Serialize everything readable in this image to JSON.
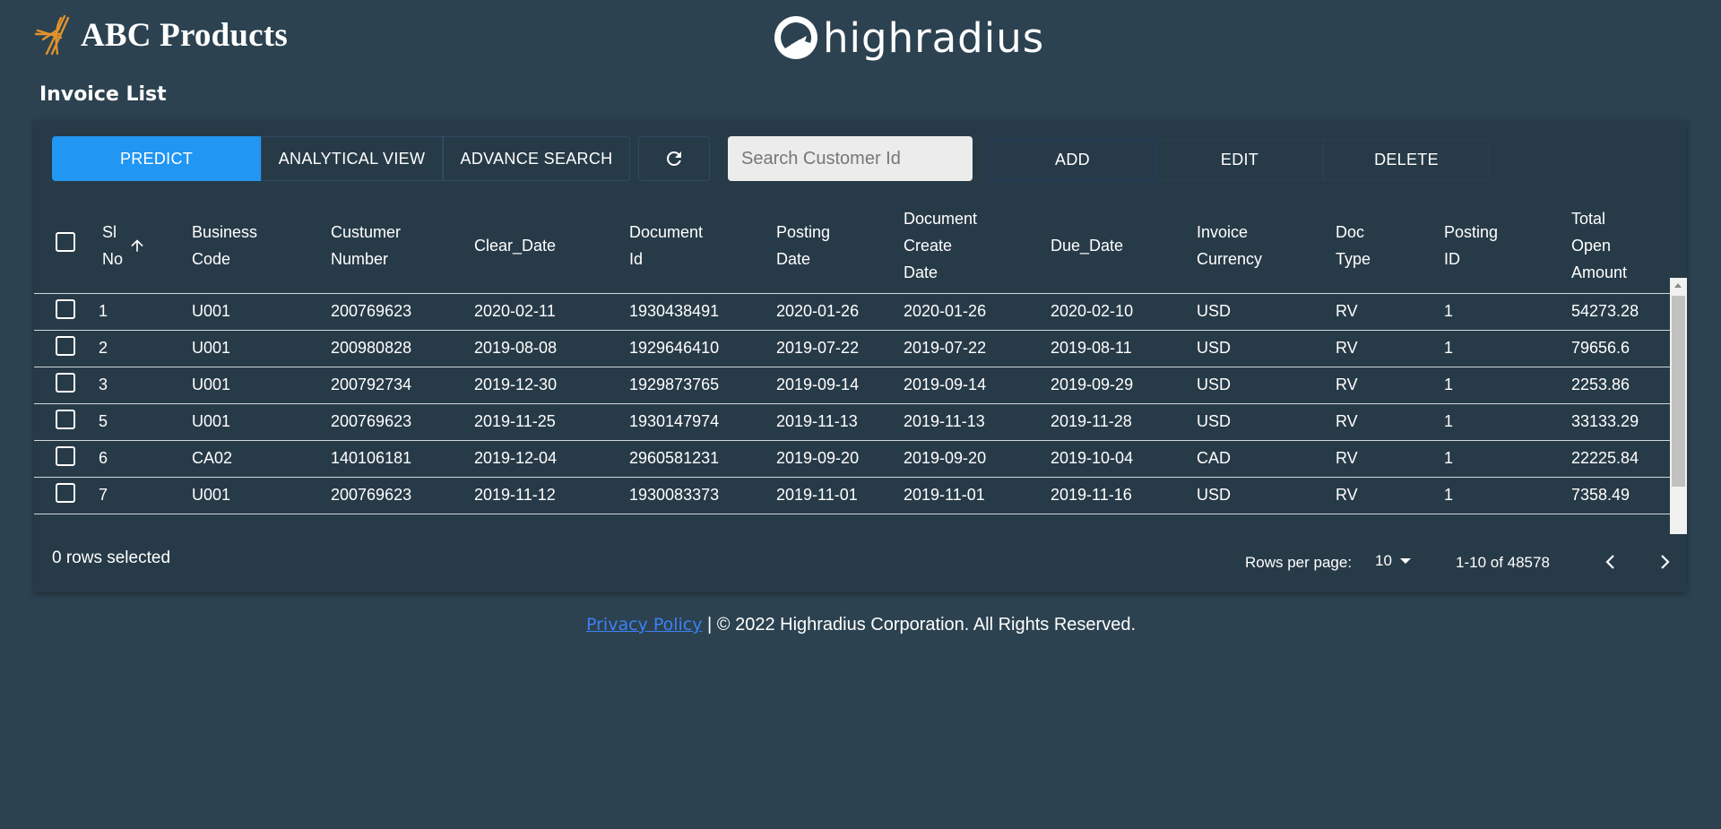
{
  "brand": {
    "name": "ABC Products",
    "logo_icon": "abc-products-logo"
  },
  "partner_logo": {
    "text": "highradius",
    "icon": "highradius-logo"
  },
  "page": {
    "title": "Invoice List"
  },
  "toolbar": {
    "predict": "PREDICT",
    "analytical_view": "ANALYTICAL VIEW",
    "advance_search": "ADVANCE SEARCH",
    "refresh_icon": "refresh-icon",
    "search_placeholder": "Search Customer Id",
    "search_value": "",
    "add": "ADD",
    "edit": "EDIT",
    "delete": "DELETE",
    "predict_color": "#2196f3"
  },
  "table": {
    "columns": [
      {
        "l1": "Sl",
        "l2": "No",
        "l3": ""
      },
      {
        "l1": "Business",
        "l2": "Code",
        "l3": ""
      },
      {
        "l1": "Custumer",
        "l2": "Number",
        "l3": ""
      },
      {
        "l1": "Clear_Date",
        "l2": "",
        "l3": ""
      },
      {
        "l1": "Document",
        "l2": "Id",
        "l3": ""
      },
      {
        "l1": "Posting",
        "l2": "Date",
        "l3": ""
      },
      {
        "l1": "Document",
        "l2": "Create",
        "l3": "Date"
      },
      {
        "l1": "Due_Date",
        "l2": "",
        "l3": ""
      },
      {
        "l1": "Invoice",
        "l2": "Currency",
        "l3": ""
      },
      {
        "l1": "Doc",
        "l2": "Type",
        "l3": ""
      },
      {
        "l1": "Posting",
        "l2": "ID",
        "l3": ""
      },
      {
        "l1": "Total",
        "l2": "Open",
        "l3": "Amount"
      }
    ],
    "sort_icon": "arrow-up-icon",
    "rows": [
      [
        "1",
        "U001",
        "200769623",
        "2020-02-11",
        "1930438491",
        "2020-01-26",
        "2020-01-26",
        "2020-02-10",
        "USD",
        "RV",
        "1",
        "54273.28"
      ],
      [
        "2",
        "U001",
        "200980828",
        "2019-08-08",
        "1929646410",
        "2019-07-22",
        "2019-07-22",
        "2019-08-11",
        "USD",
        "RV",
        "1",
        "79656.6"
      ],
      [
        "3",
        "U001",
        "200792734",
        "2019-12-30",
        "1929873765",
        "2019-09-14",
        "2019-09-14",
        "2019-09-29",
        "USD",
        "RV",
        "1",
        "2253.86"
      ],
      [
        "5",
        "U001",
        "200769623",
        "2019-11-25",
        "1930147974",
        "2019-11-13",
        "2019-11-13",
        "2019-11-28",
        "USD",
        "RV",
        "1",
        "33133.29"
      ],
      [
        "6",
        "CA02",
        "140106181",
        "2019-12-04",
        "2960581231",
        "2019-09-20",
        "2019-09-20",
        "2019-10-04",
        "CAD",
        "RV",
        "1",
        "22225.84"
      ],
      [
        "7",
        "U001",
        "200769623",
        "2019-11-12",
        "1930083373",
        "2019-11-01",
        "2019-11-01",
        "2019-11-16",
        "USD",
        "RV",
        "1",
        "7358.49"
      ]
    ]
  },
  "pagination": {
    "rows_selected": "0 rows selected",
    "rows_per_page_label": "Rows per page:",
    "rows_per_page_value": "10",
    "range": "1-10 of 48578",
    "prev_icon": "chevron-left-icon",
    "next_icon": "chevron-right-icon"
  },
  "footer": {
    "privacy_link": "Privacy Policy",
    "copyright": "| © 2022 Highradius Corporation. All Rights Reserved."
  }
}
